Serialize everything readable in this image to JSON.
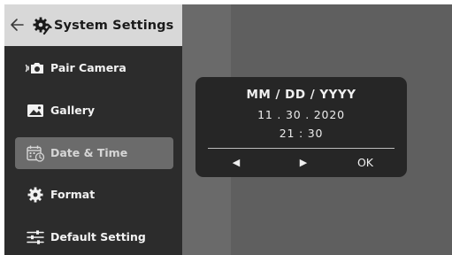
{
  "header": {
    "title": "System Settings",
    "back_icon": "back-arrow-icon",
    "title_icon": "gear-wrench-icon"
  },
  "sidebar": {
    "items": [
      {
        "label": "Pair Camera",
        "icon": "pair-camera-icon",
        "active": false
      },
      {
        "label": "Gallery",
        "icon": "gallery-icon",
        "active": false
      },
      {
        "label": "Date & Time",
        "icon": "calendar-clock-icon",
        "active": true
      },
      {
        "label": "Format",
        "icon": "format-gear-icon",
        "active": false
      },
      {
        "label": "Default Setting",
        "icon": "sliders-icon",
        "active": false
      }
    ]
  },
  "dialog": {
    "format": "MM / DD / YYYY",
    "date": "11 . 30 . 2020",
    "time": "21 : 30",
    "left_label": "◀",
    "right_label": "▶",
    "ok_label": "OK"
  },
  "colors": {
    "sidebar_bg": "#2c2c2c",
    "header_bg": "#d8d8d8",
    "active_item_bg": "#6b6b6b",
    "dialog_bg": "#262626",
    "screen_bg": "#6a6a6a"
  }
}
